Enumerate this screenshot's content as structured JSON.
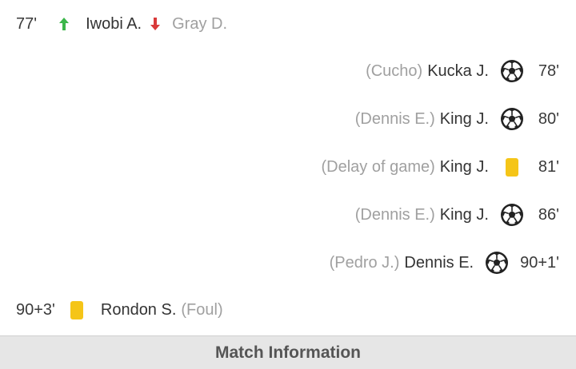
{
  "events": [
    {
      "side": "home",
      "type": "substitution",
      "minute": "77'",
      "player_in": "Iwobi A.",
      "player_out": "Gray D.",
      "icon_in": "arrow-up-icon",
      "icon_out": "arrow-down-icon"
    },
    {
      "side": "away",
      "type": "goal",
      "assist": "(Cucho)",
      "player": "Kucka J.",
      "minute": "78'",
      "icon": "soccer-ball-icon"
    },
    {
      "side": "away",
      "type": "goal",
      "assist": "(Dennis E.)",
      "player": "King J.",
      "minute": "80'",
      "icon": "soccer-ball-icon"
    },
    {
      "side": "away",
      "type": "yellow-card",
      "reason": "(Delay of game)",
      "player": "King J.",
      "minute": "81'",
      "icon": "yellow-card-icon"
    },
    {
      "side": "away",
      "type": "goal",
      "assist": "(Dennis E.)",
      "player": "King J.",
      "minute": "86'",
      "icon": "soccer-ball-icon"
    },
    {
      "side": "away",
      "type": "goal",
      "assist": "(Pedro J.)",
      "player": "Dennis E.",
      "minute": "90+1'",
      "icon": "soccer-ball-icon"
    },
    {
      "side": "home",
      "type": "yellow-card",
      "minute": "90+3'",
      "player": "Rondon S.",
      "reason": "(Foul)",
      "icon": "yellow-card-icon"
    }
  ],
  "footer": {
    "label": "Match Information"
  },
  "colors": {
    "arrow_in": "#3cb64a",
    "arrow_out": "#d93a3a",
    "yellow_card": "#f5c518",
    "muted_text": "#a0a0a0",
    "footer_bg": "#e6e6e6"
  }
}
